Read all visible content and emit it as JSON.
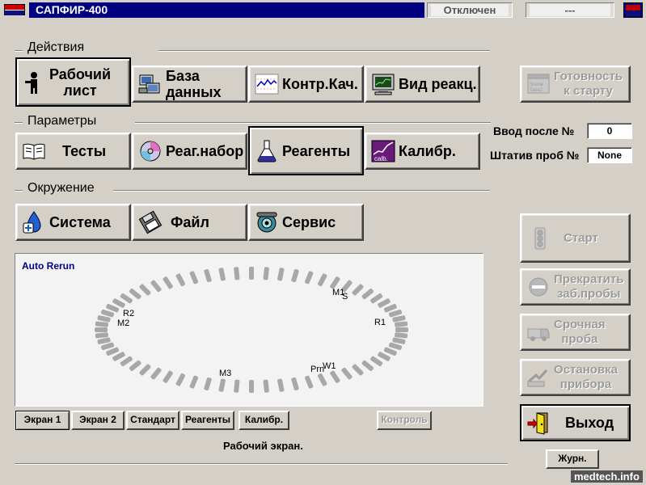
{
  "titlebar": {
    "app_title": "САПФИР-400",
    "status": "Отключен",
    "status2": "---"
  },
  "groups": {
    "actions": "Действия",
    "params": "Параметры",
    "env": "Окружение"
  },
  "buttons": {
    "worksheet": [
      "Рабочий",
      "лист"
    ],
    "database": [
      "База",
      "данных"
    ],
    "qc": "Контр.Кач.",
    "reaction": "Вид реакц.",
    "tests": "Тесты",
    "reagset": "Реаг.набор",
    "reagents": "Реагенты",
    "calib": "Калибр.",
    "system": "Система",
    "file": "Файл",
    "service": "Сервис",
    "ready": [
      "Готовность",
      "к старту"
    ],
    "start": "Старт",
    "stop_samples": [
      "Прекратить",
      "заб.пробы"
    ],
    "urgent": [
      "Срочная",
      "проба"
    ],
    "halt": [
      "Остановка",
      "прибора"
    ],
    "exit": "Выход",
    "journal": "Журн."
  },
  "fields": {
    "input_after_label": "Ввод после №",
    "input_after_value": "0",
    "rack_label": "Штатив проб №",
    "rack_value": "None"
  },
  "panel": {
    "title": "Auto Rerun",
    "positions": {
      "m1": "M1",
      "s": "S",
      "r1": "R1",
      "r2": "R2",
      "m2": "M2",
      "m3": "M3",
      "w1": "W1",
      "prn": "Prn"
    }
  },
  "screen_tabs": [
    "Экран 1",
    "Экран 2",
    "Стандарт",
    "Реагенты",
    "Калибр."
  ],
  "control_button": "Контроль",
  "status_text": "Рабочий экран.",
  "watermark": "medtech.info"
}
